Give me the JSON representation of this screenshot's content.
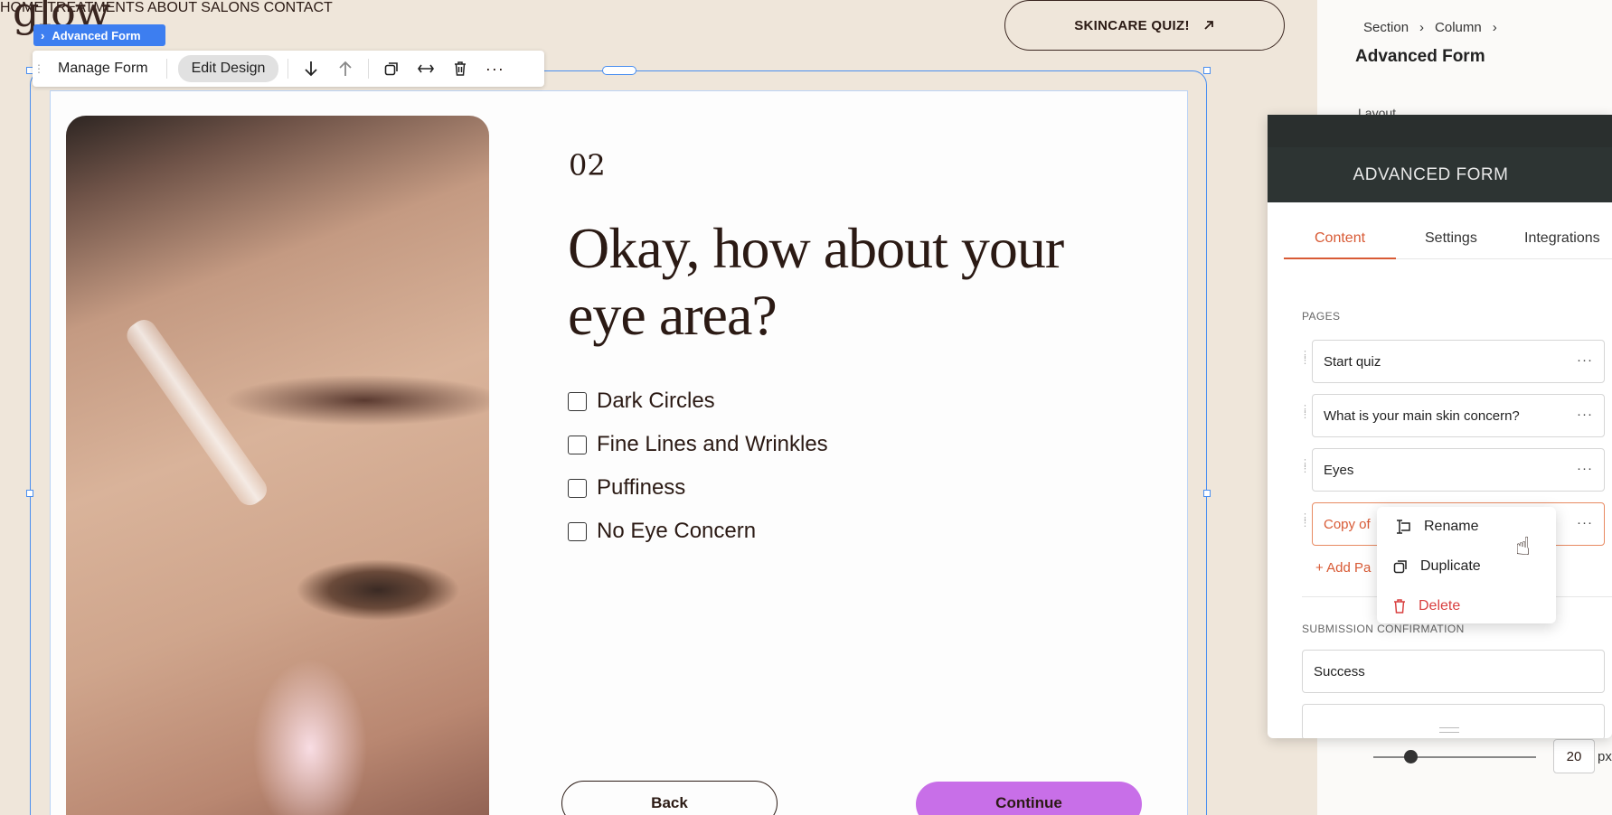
{
  "site": {
    "logo": "glow",
    "nav": [
      "HOME",
      "TREATMENTS",
      "ABOUT",
      "SALONS",
      "CONTACT"
    ],
    "quiz_button": "SKINCARE QUIZ!"
  },
  "editor": {
    "selection_tag": "Advanced Form",
    "toolbar": {
      "manage_form": "Manage Form",
      "edit_design": "Edit Design"
    }
  },
  "form": {
    "step_number": "02",
    "question": "Okay, how about your eye area?",
    "options": [
      "Dark Circles",
      "Fine Lines and Wrinkles",
      "Puffiness",
      "No Eye Concern"
    ],
    "back_label": "Back",
    "continue_label": "Continue"
  },
  "inspector": {
    "breadcrumb": [
      "Section",
      "Column"
    ],
    "title": "Advanced Form",
    "layout_label": "Layout",
    "spacing_value": "20",
    "spacing_unit": "px"
  },
  "panel": {
    "title": "ADVANCED FORM",
    "tabs": [
      "Content",
      "Settings",
      "Integrations"
    ],
    "pages_label": "PAGES",
    "pages": [
      "Start quiz",
      "What is your main skin concern?",
      "Eyes",
      "Copy of"
    ],
    "add_page": "+ Add Pa",
    "submission_label": "SUBMISSION CONFIRMATION",
    "submission_item": "Success"
  },
  "context_menu": {
    "items": [
      "Rename",
      "Duplicate",
      "Delete"
    ]
  },
  "colors": {
    "accent": "#d85a35",
    "selection": "#3d7ef0",
    "continue": "#c86fe8",
    "delete": "#d94040"
  }
}
